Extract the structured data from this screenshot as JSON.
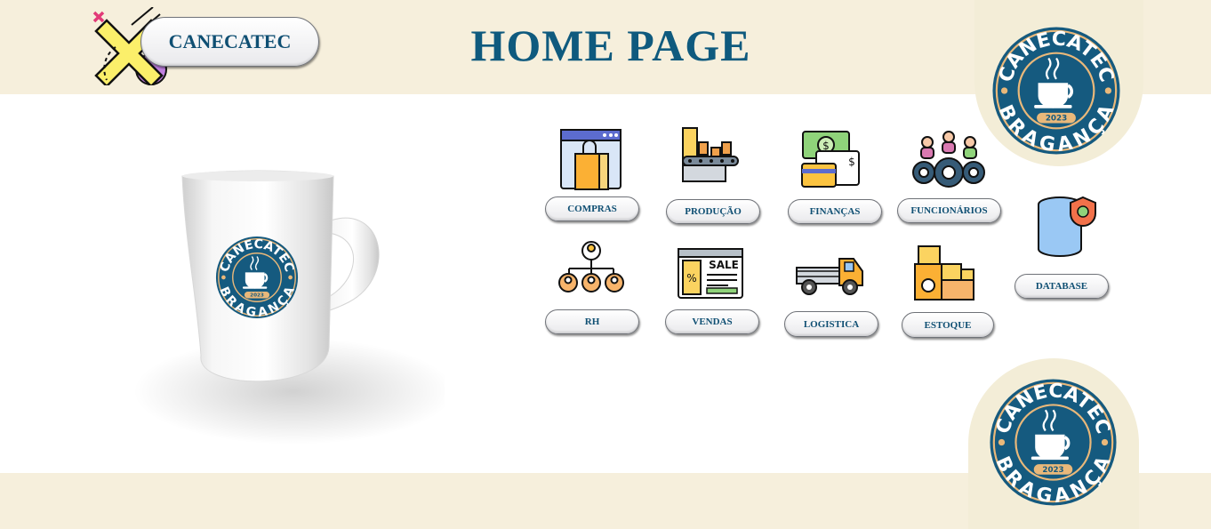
{
  "header": {
    "title": "HOME PAGE",
    "brand_button": "CANECATEC"
  },
  "logo": {
    "top_text": "CANECATEC",
    "bottom_text": "BRAGANÇA",
    "year": "2023"
  },
  "menu": {
    "compras": "COMPRAS",
    "producao": "PRODUÇÃO",
    "financas": "FINANÇAS",
    "funcionarios": "FUNCIONÁRIOS",
    "database": "DATABASE",
    "rh": "RH",
    "vendas": "VENDAS",
    "logistica": "LOGISTICA",
    "estoque": "ESTOQUE"
  },
  "icons": {
    "compras": "shopping-bag-browser-icon",
    "producao": "factory-conveyor-icon",
    "financas": "money-card-check-icon",
    "funcionarios": "people-gears-icon",
    "database": "database-shield-icon",
    "rh": "org-chart-icon",
    "vendas": "sale-webpage-icon",
    "logistica": "delivery-truck-icon",
    "estoque": "stock-boxes-icon"
  },
  "colors": {
    "band": "#f6efdc",
    "title": "#0f5a7e",
    "logo_blue": "#155a7f",
    "logo_gold": "#e9b87a"
  }
}
